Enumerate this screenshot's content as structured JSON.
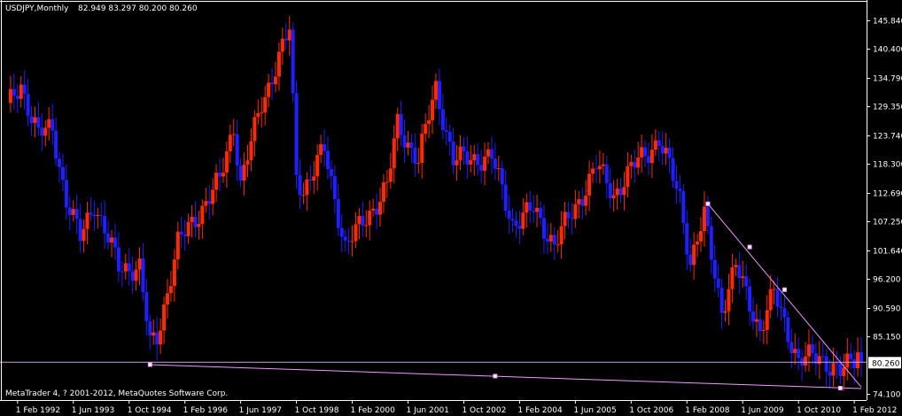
{
  "header": {
    "symbol": "USDJPY,Monthly",
    "ohlc": "82.949 83.297 80.200 80.260"
  },
  "footer": {
    "copyright": "MetaTrader 4, ? 2001-2012, MetaQuotes Software Corp."
  },
  "colors": {
    "background": "#000000",
    "up_candle": "#ff2a00",
    "down_candle": "#1f1fff",
    "axis": "#ffffff",
    "trendline": "#ee9bff",
    "price_line": "#c8a2e0",
    "highlight_candle": "#2fdc2f"
  },
  "chart_data": {
    "type": "candlestick",
    "timeframe": "Monthly",
    "symbol": "USDJPY",
    "current_price": "80.260",
    "ylim": [
      73.0,
      149.5
    ],
    "yticks": [
      "145.840",
      "140.400",
      "134.790",
      "129.350",
      "123.740",
      "118.300",
      "112.690",
      "107.250",
      "101.640",
      "96.200",
      "90.590",
      "85.150",
      "74.100"
    ],
    "xticks": [
      "1 Feb 1992",
      "1 Jun 1993",
      "1 Oct 1994",
      "1 Feb 1996",
      "1 Jun 1997",
      "1 Oct 1998",
      "1 Feb 2000",
      "1 Jun 2001",
      "1 Oct 2002",
      "1 Feb 2004",
      "1 Jun 2005",
      "1 Oct 2006",
      "1 Feb 2008",
      "1 Jun 2009",
      "1 Oct 2010",
      "1 Feb 2012"
    ],
    "anchors": [
      {
        "date": "1991-11",
        "close": 129.0
      },
      {
        "date": "1992-03",
        "close": 133.5
      },
      {
        "date": "1992-08",
        "close": 124.0
      },
      {
        "date": "1992-12",
        "close": 125.0
      },
      {
        "date": "1993-04",
        "close": 111.5
      },
      {
        "date": "1993-08",
        "close": 104.0
      },
      {
        "date": "1993-12",
        "close": 111.0
      },
      {
        "date": "1994-07",
        "close": 98.5
      },
      {
        "date": "1995-01",
        "close": 98.5
      },
      {
        "date": "1995-04",
        "close": 83.5
      },
      {
        "date": "1995-06",
        "close": 85.0
      },
      {
        "date": "1995-12",
        "close": 103.0
      },
      {
        "date": "1996-06",
        "close": 109.0
      },
      {
        "date": "1996-12",
        "close": 115.0
      },
      {
        "date": "1997-04",
        "close": 126.0
      },
      {
        "date": "1997-06",
        "close": 114.5
      },
      {
        "date": "1997-12",
        "close": 130.0
      },
      {
        "date": "1998-08",
        "close": 144.0
      },
      {
        "date": "1998-10",
        "close": 116.0
      },
      {
        "date": "1998-12",
        "close": 113.5
      },
      {
        "date": "1999-06",
        "close": 121.0
      },
      {
        "date": "1999-12",
        "close": 102.5
      },
      {
        "date": "2000-04",
        "close": 106.0
      },
      {
        "date": "2000-12",
        "close": 114.0
      },
      {
        "date": "2001-03",
        "close": 126.0
      },
      {
        "date": "2001-09",
        "close": 119.0
      },
      {
        "date": "2002-02",
        "close": 133.0
      },
      {
        "date": "2002-07",
        "close": 119.0
      },
      {
        "date": "2002-12",
        "close": 119.5
      },
      {
        "date": "2003-06",
        "close": 119.5
      },
      {
        "date": "2003-12",
        "close": 107.0
      },
      {
        "date": "2004-06",
        "close": 109.5
      },
      {
        "date": "2004-12",
        "close": 103.0
      },
      {
        "date": "2005-06",
        "close": 110.0
      },
      {
        "date": "2005-12",
        "close": 118.0
      },
      {
        "date": "2006-05",
        "close": 112.5
      },
      {
        "date": "2006-12",
        "close": 119.0
      },
      {
        "date": "2007-06",
        "close": 123.0
      },
      {
        "date": "2007-12",
        "close": 112.0
      },
      {
        "date": "2008-03",
        "close": 99.5
      },
      {
        "date": "2008-07",
        "close": 108.0
      },
      {
        "date": "2008-12",
        "close": 90.5
      },
      {
        "date": "2009-04",
        "close": 98.5
      },
      {
        "date": "2009-11",
        "close": 86.5
      },
      {
        "date": "2010-03",
        "close": 93.5
      },
      {
        "date": "2010-10",
        "close": 80.5
      },
      {
        "date": "2011-04",
        "close": 81.5
      },
      {
        "date": "2011-10",
        "close": 78.0
      },
      {
        "date": "2012-02",
        "close": 81.2
      },
      {
        "date": "2012-03",
        "close": 83.0
      },
      {
        "date": "2012-04",
        "close": 80.26
      }
    ],
    "objects": {
      "horizontal_line": {
        "price": 80.26
      },
      "trendlines": [
        {
          "from": {
            "date": "1995-04",
            "price": 79.8
          },
          "to": {
            "date": "2012-04",
            "price": 75.2
          }
        },
        {
          "from": {
            "date": "2008-08",
            "price": 110.7
          },
          "to": {
            "date": "2012-04",
            "price": 75.5
          }
        }
      ],
      "markers": [
        {
          "date": "1995-04",
          "price": 79.8
        },
        {
          "date": "2003-07",
          "price": 77.6
        },
        {
          "date": "2008-08",
          "price": 110.7
        },
        {
          "date": "2009-08",
          "price": 102.4
        },
        {
          "date": "2010-06",
          "price": 94.2
        },
        {
          "date": "2011-10",
          "price": 75.3
        }
      ]
    }
  }
}
